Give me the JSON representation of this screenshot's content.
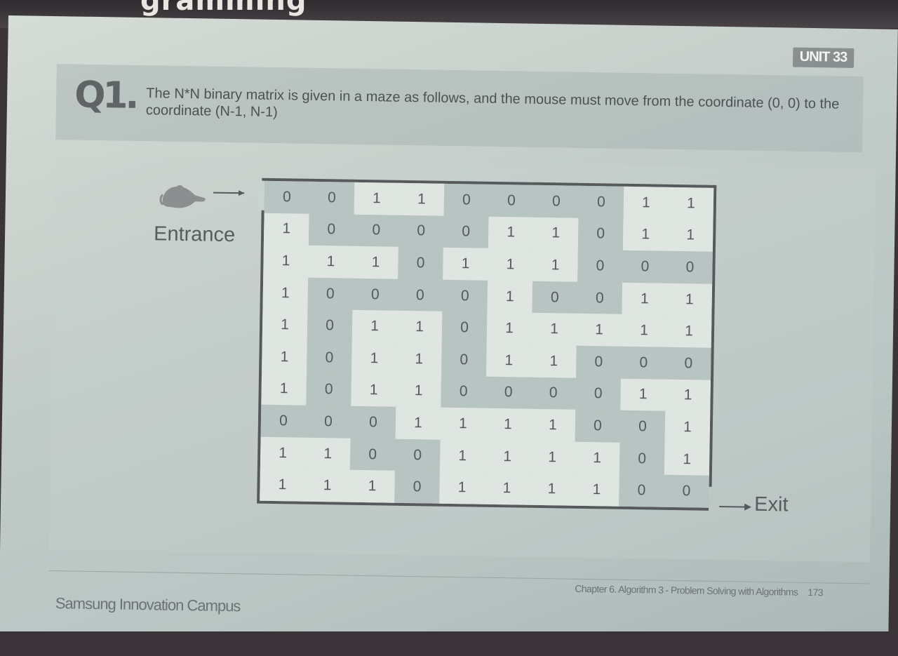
{
  "header": {
    "top_title": "gramming"
  },
  "slide": {
    "unit": "UNIT 33",
    "question": {
      "number": "Q1.",
      "text": "The N*N binary matrix is given in a maze as follows, and the mouse must move from the coordinate (0, 0) to the coordinate (N-1, N-1)"
    },
    "maze": {
      "entrance_label": "Entrance",
      "exit_label": "Exit",
      "icons": {
        "mouse": "mouse-icon",
        "entrance_arrow": "arrow-right-icon",
        "exit_arrow": "arrow-right-icon"
      },
      "rows": [
        [
          0,
          0,
          1,
          1,
          0,
          0,
          0,
          0,
          1,
          1
        ],
        [
          1,
          0,
          0,
          0,
          0,
          1,
          1,
          0,
          1,
          1
        ],
        [
          1,
          1,
          1,
          0,
          1,
          1,
          1,
          0,
          0,
          0
        ],
        [
          1,
          0,
          0,
          0,
          0,
          1,
          0,
          0,
          1,
          1
        ],
        [
          1,
          0,
          1,
          1,
          0,
          1,
          1,
          1,
          1,
          1
        ],
        [
          1,
          0,
          1,
          1,
          0,
          1,
          1,
          0,
          0,
          0
        ],
        [
          1,
          0,
          1,
          1,
          0,
          0,
          0,
          0,
          1,
          1
        ],
        [
          0,
          0,
          0,
          1,
          1,
          1,
          1,
          0,
          0,
          1
        ],
        [
          1,
          1,
          0,
          0,
          1,
          1,
          1,
          1,
          0,
          1
        ],
        [
          1,
          1,
          1,
          0,
          1,
          1,
          1,
          1,
          0,
          0
        ]
      ],
      "colors": {
        "wall": "#dfe6e1",
        "path": "#b8c4c2",
        "border": "#565a5c"
      }
    },
    "footer": {
      "left": "Samsung Innovation Campus",
      "right": "Chapter 6. Algorithm 3 - Problem Solving with Algorithms",
      "page": "173"
    }
  }
}
